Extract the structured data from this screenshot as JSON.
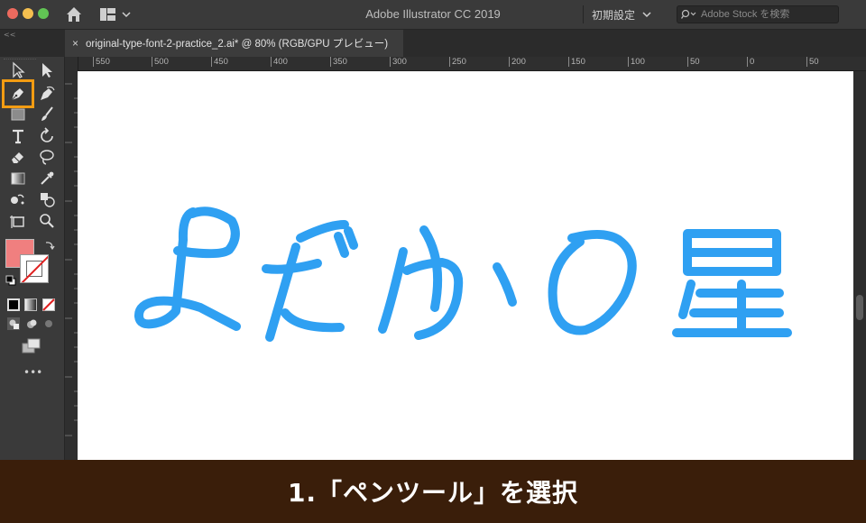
{
  "window": {
    "title": "Adobe Illustrator CC 2019",
    "workspace_label": "初期設定",
    "search_placeholder": "Adobe Stock を検索"
  },
  "document_tab": {
    "close_glyph": "×",
    "label": "original-type-font-2-practice_2.ai* @ 80% (RGB/GPU プレビュー)"
  },
  "ruler": {
    "top_ticks": [
      "550",
      "500",
      "450",
      "400",
      "350",
      "300",
      "250",
      "200",
      "150",
      "100",
      "50",
      "0",
      "50"
    ]
  },
  "toolbar": {
    "collapse_glyph": "<<",
    "more_glyph": "•••",
    "highlighted_tool": "pen-tool",
    "fill_color": "#f07f7f",
    "stroke_color": "none",
    "highlight_color": "#f39c12"
  },
  "artwork": {
    "text": "よだかの星",
    "color": "#2fa0f2"
  },
  "caption": {
    "text": "1.「ペンツール」を選択",
    "background": "#3a1e0a"
  }
}
